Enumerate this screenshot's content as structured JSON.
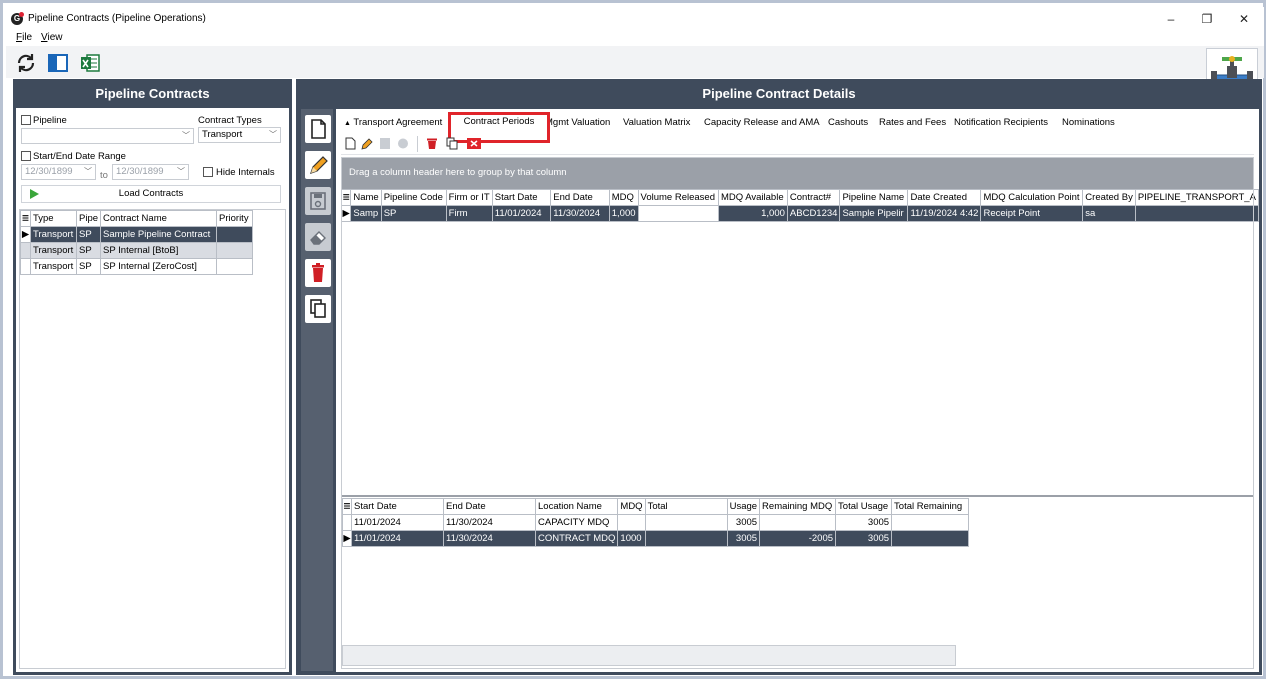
{
  "window": {
    "title": "Pipeline Contracts (Pipeline Operations)",
    "controls": {
      "minimize": "–",
      "restore": "❐",
      "close": "✕"
    }
  },
  "menu": [
    {
      "label": "File",
      "accel": "F",
      "rest": "ile"
    },
    {
      "label": "View",
      "accel": "V",
      "rest": "iew"
    }
  ],
  "toolbar_icons": [
    "refresh-icon",
    "panel-toggle-icon",
    "excel-export-icon",
    "pipeline-valve-icon"
  ],
  "left": {
    "title": "Pipeline Contracts",
    "pipeline_label": "Pipeline",
    "pipeline_value": "",
    "contract_types_label": "Contract Types",
    "contract_types_value": "Transport",
    "date_range_label": "Start/End Date Range",
    "start_date": "12/30/1899",
    "to_label": "to",
    "end_date": "12/30/1899",
    "hide_internals_label": "Hide Internals",
    "load_button": "Load Contracts",
    "table": {
      "columns": [
        "Type",
        "Pipe",
        "Contract Name",
        "Priority"
      ],
      "rows": [
        [
          "Transport",
          "SP",
          "Sample Pipeline Contract",
          ""
        ],
        [
          "Transport",
          "SP",
          "SP Internal [BtoB]",
          ""
        ],
        [
          "Transport",
          "SP",
          "SP Internal [ZeroCost]",
          ""
        ]
      ]
    }
  },
  "right": {
    "title": "Pipeline Contract Details",
    "tabs": [
      "Transport Agreement",
      "Contract Periods",
      "Mgmt Valuation",
      "Valuation Matrix",
      "Capacity Release and AMA",
      "Cashouts",
      "Rates and Fees",
      "Notification Recipients",
      "Nominations"
    ],
    "tab_first_marker": "▲",
    "active_tab": "Contract Periods",
    "group_hint": "Drag a column header here to group by that column",
    "periods": {
      "columns": [
        "Name",
        "Pipeline Code",
        "Firm or IT",
        "Start Date",
        "End Date",
        "MDQ",
        "Volume Released",
        "MDQ Available",
        "Contract#",
        "Pipeline Name",
        "Date Created",
        "MDQ Calculation Point",
        "Created By",
        "PIPELINE_TRANSPORT_A"
      ],
      "rows": [
        [
          "Samp",
          "SP",
          "Firm",
          "11/01/2024",
          "11/30/2024",
          "1,000",
          "",
          "1,000",
          "ABCD1234",
          "Sample Pipelir",
          "11/19/2024 4:42",
          "Receipt Point",
          "sa",
          ""
        ]
      ]
    },
    "locations": {
      "columns": [
        "Start Date",
        "End Date",
        "Location Name",
        "MDQ",
        "Total",
        "Usage",
        "Remaining MDQ",
        "Total Usage",
        "Total Remaining"
      ],
      "rows": [
        [
          "11/01/2024",
          "11/30/2024",
          "CAPACITY MDQ",
          "",
          "",
          "3005",
          "",
          "3005",
          ""
        ],
        [
          "11/01/2024",
          "11/30/2024",
          "CONTRACT MDQ",
          "1000",
          "",
          "3005",
          "-2005",
          "3005",
          ""
        ]
      ]
    }
  },
  "colors": {
    "panel_dark": "#3f4b5c",
    "accent_red": "#e0242a",
    "row_selected": "#3f4b5c"
  }
}
